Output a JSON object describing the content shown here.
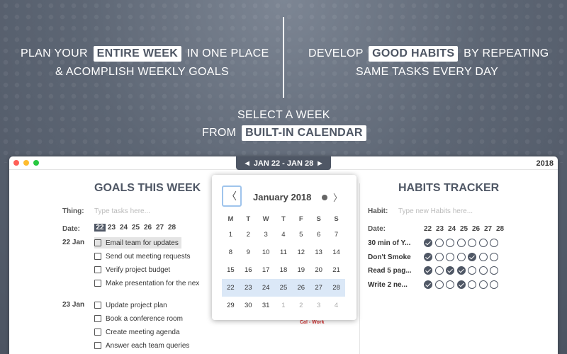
{
  "promo": {
    "left_line1_pre": "PLAN YOUR",
    "left_line1_hl": "ENTIRE WEEK",
    "left_line1_post": "IN ONE PLACE",
    "left_line2": "& ACOMPLISH WEEKLY GOALS",
    "right_line1_pre": "DEVELOP",
    "right_line1_hl": "GOOD HABITS",
    "right_line1_post": "BY REPEATING",
    "right_line2": "SAME TASKS EVERY DAY",
    "center_line1": "SELECT A WEEK",
    "center_line2_pre": "FROM",
    "center_line2_hl": "BUILT-IN CALENDAR"
  },
  "window": {
    "year": "2018",
    "week_prev": "◀",
    "week_label": "JAN 22 - JAN 28",
    "week_next": "▶",
    "colors": {
      "red": "#ff5f57",
      "yellow": "#febc2e",
      "green": "#28c840"
    }
  },
  "goals": {
    "title": "GOALS THIS WEEK",
    "thing_label": "Thing:",
    "thing_placeholder": "Type tasks here...",
    "date_label": "Date:",
    "days": [
      "22",
      "23",
      "24",
      "25",
      "26",
      "27",
      "28"
    ],
    "selected_day": "22",
    "groups": [
      {
        "date": "22 Jan",
        "tasks": [
          "Email team for updates",
          "Send out meeting requests",
          "Verify project budget",
          "Make presentation for the nex"
        ]
      },
      {
        "date": "23 Jan",
        "tasks": [
          "Update project plan",
          "Book a conference room",
          "Create meeting agenda",
          "Answer each team queries"
        ]
      }
    ],
    "tag": "Cal - Work"
  },
  "habits": {
    "title": "HABITS TRACKER",
    "habit_label": "Habit:",
    "habit_placeholder": "Type new Habits here...",
    "date_label": "Date:",
    "days": [
      "22",
      "23",
      "24",
      "25",
      "26",
      "27",
      "28"
    ],
    "rows": [
      {
        "name": "30 min of Y...",
        "done": [
          true,
          false,
          false,
          false,
          false,
          false,
          false
        ]
      },
      {
        "name": "Don't Smoke",
        "done": [
          true,
          false,
          false,
          false,
          true,
          false,
          false
        ]
      },
      {
        "name": "Read 5 pag...",
        "done": [
          true,
          false,
          true,
          true,
          false,
          false,
          false
        ]
      },
      {
        "name": "Write 2 ne...",
        "done": [
          true,
          false,
          false,
          true,
          false,
          false,
          false
        ]
      }
    ]
  },
  "calendar": {
    "prev": "〈",
    "month": "January 2018",
    "next": "〉",
    "weekdays": [
      "M",
      "T",
      "W",
      "T",
      "F",
      "S",
      "S"
    ],
    "weeks": [
      [
        "1",
        "2",
        "3",
        "4",
        "5",
        "6",
        "7"
      ],
      [
        "8",
        "9",
        "10",
        "11",
        "12",
        "13",
        "14"
      ],
      [
        "15",
        "16",
        "17",
        "18",
        "19",
        "20",
        "21"
      ],
      [
        "22",
        "23",
        "24",
        "25",
        "26",
        "27",
        "28"
      ],
      [
        "29",
        "30",
        "31",
        "1",
        "2",
        "3",
        "4"
      ]
    ],
    "selected_week_index": 3
  }
}
